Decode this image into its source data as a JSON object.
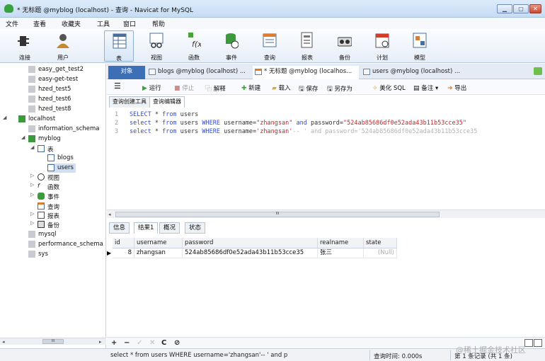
{
  "window": {
    "title": "* 无标题 @myblog (localhost) - 查询 - Navicat for MySQL"
  },
  "menu": [
    "文件",
    "查看",
    "收藏夹",
    "工具",
    "窗口",
    "帮助"
  ],
  "toolbar": [
    {
      "label": "连接",
      "icon": "connect-icon"
    },
    {
      "label": "用户",
      "icon": "user-icon"
    },
    {
      "label": "表",
      "icon": "table-icon"
    },
    {
      "label": "视图",
      "icon": "view-icon"
    },
    {
      "label": "函数",
      "icon": "function-icon"
    },
    {
      "label": "事件",
      "icon": "event-icon"
    },
    {
      "label": "查询",
      "icon": "query-icon"
    },
    {
      "label": "报表",
      "icon": "report-icon"
    },
    {
      "label": "备份",
      "icon": "backup-icon"
    },
    {
      "label": "计划",
      "icon": "schedule-icon"
    },
    {
      "label": "模型",
      "icon": "model-icon"
    }
  ],
  "sidebar": {
    "items": [
      {
        "label": "easy_get_test2"
      },
      {
        "label": "easy-get-test"
      },
      {
        "label": "hzed_test5"
      },
      {
        "label": "hzed_test6"
      },
      {
        "label": "hzed_test8"
      },
      {
        "label": "localhost"
      },
      {
        "label": "information_schema"
      },
      {
        "label": "myblog"
      },
      {
        "label": "表"
      },
      {
        "label": "blogs"
      },
      {
        "label": "users"
      },
      {
        "label": "视图"
      },
      {
        "label": "函数"
      },
      {
        "label": "事件"
      },
      {
        "label": "查询"
      },
      {
        "label": "报表"
      },
      {
        "label": "备份"
      },
      {
        "label": "mysql"
      },
      {
        "label": "performance_schema"
      },
      {
        "label": "sys"
      }
    ],
    "scroll_thumb": "III"
  },
  "tabs": [
    {
      "label": "对象"
    },
    {
      "label": "blogs @myblog (localhost) ..."
    },
    {
      "label": "* 无标题 @myblog (localhos..."
    },
    {
      "label": "users @myblog (localhost) ..."
    }
  ],
  "query_toolbar": {
    "run": "运行",
    "stop": "停止",
    "explain": "解释",
    "new": "新建",
    "load": "载入",
    "save": "保存",
    "save_as": "另存为",
    "beautify": "美化 SQL",
    "comment": "备注",
    "export": "导出"
  },
  "subtabs": [
    "查询创建工具",
    "查询编辑器"
  ],
  "editor": {
    "lines": [
      {
        "num": "1",
        "kw1": "SELECT",
        "t1": " * ",
        "kw2": "from",
        "t2": " users",
        "kw3": "",
        "t3": "",
        "str1": "",
        "t4": "",
        "kw4": "",
        "t5": "",
        "str2": "",
        "cmt": ""
      },
      {
        "num": "2",
        "kw1": "select",
        "t1": " * ",
        "kw2": "from",
        "t2": " users ",
        "kw3": "WHERE",
        "t3": " username=",
        "str1": "\"zhangsan\"",
        "t4": " ",
        "kw4": "and",
        "t5": " password=",
        "str2": "\"524ab85686df0e52ada43b11b53cce35\"",
        "cmt": ""
      },
      {
        "num": "3",
        "kw1": "select",
        "t1": " * ",
        "kw2": "from",
        "t2": " users ",
        "kw3": "WHERE",
        "t3": " username=",
        "str1": "'zhangsan'",
        "t4": "",
        "kw4": "",
        "t5": "",
        "str2": "",
        "cmt": "-- ' and password='524ab85686df0e52ada43b11b53cce35"
      }
    ],
    "scroll_thumb": "III"
  },
  "result": {
    "tabs": [
      "信息",
      "结果1",
      "概况",
      "状态"
    ],
    "columns": [
      "id",
      "username",
      "password",
      "realname",
      "state"
    ],
    "rows": [
      [
        "8",
        "zhangsan",
        "524ab85686df0e52ada43b11b53cce35",
        "张三",
        "(Null)"
      ]
    ]
  },
  "nav": {
    "add": "+",
    "delete": "−",
    "apply": "✓",
    "discard": "✕",
    "refresh": "C",
    "stop": "⊘"
  },
  "status": {
    "sql": "select * from users WHERE username='zhangsan'-- ' and p",
    "query_time": "查询时间: 0.000s",
    "record": "第 1 条记录 (共 1 条)"
  },
  "watermark": "@稀土掘金技术社区"
}
